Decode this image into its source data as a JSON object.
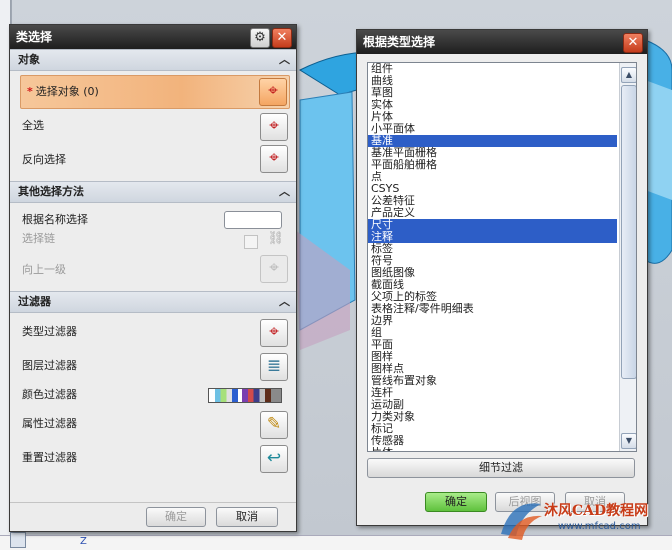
{
  "dialog_class_select": {
    "title": "类选择",
    "objects_section": {
      "title": "对象",
      "select_label": "选择对象 (0)",
      "select_all": "全选",
      "invert": "反向选择"
    },
    "other_methods_section": {
      "title": "其他选择方法",
      "by_name": "根据名称选择",
      "chain": "选择链",
      "up_level": "向上一级"
    },
    "filters_section": {
      "title": "过滤器",
      "type_filter": "类型过滤器",
      "layer_filter": "图层过滤器",
      "color_filter": "颜色过滤器",
      "attribute_filter": "属性过滤器",
      "reset_filter": "重置过滤器"
    },
    "ok": "确定",
    "cancel": "取消"
  },
  "dialog_by_type": {
    "title": "根据类型选择",
    "items": [
      {
        "label": "组件",
        "selected": false
      },
      {
        "label": "曲线",
        "selected": false
      },
      {
        "label": "草图",
        "selected": false
      },
      {
        "label": "实体",
        "selected": false
      },
      {
        "label": "片体",
        "selected": false
      },
      {
        "label": "小平面体",
        "selected": false
      },
      {
        "label": "基准",
        "selected": true
      },
      {
        "label": "基准平面栅格",
        "selected": false
      },
      {
        "label": "平面船舶栅格",
        "selected": false
      },
      {
        "label": "点",
        "selected": false
      },
      {
        "label": "CSYS",
        "selected": false
      },
      {
        "label": "公差特征",
        "selected": false
      },
      {
        "label": "产品定义",
        "selected": false
      },
      {
        "label": "尺寸",
        "selected": true
      },
      {
        "label": "注释",
        "selected": true
      },
      {
        "label": "标签",
        "selected": false
      },
      {
        "label": "符号",
        "selected": false
      },
      {
        "label": "图纸图像",
        "selected": false
      },
      {
        "label": "截面线",
        "selected": false
      },
      {
        "label": "父项上的标签",
        "selected": false
      },
      {
        "label": "表格注释/零件明细表",
        "selected": false
      },
      {
        "label": "边界",
        "selected": false
      },
      {
        "label": "组",
        "selected": false
      },
      {
        "label": "平面",
        "selected": false
      },
      {
        "label": "图样",
        "selected": false
      },
      {
        "label": "图样点",
        "selected": false
      },
      {
        "label": "管线布置对象",
        "selected": false
      },
      {
        "label": "连杆",
        "selected": false
      },
      {
        "label": "运动副",
        "selected": false
      },
      {
        "label": "力类对象",
        "selected": false
      },
      {
        "label": "标记",
        "selected": false
      },
      {
        "label": "传感器",
        "selected": false
      },
      {
        "label": "片体",
        "selected": false
      }
    ],
    "detail_filter": "细节过滤",
    "ok": "确定",
    "back": "后视图",
    "cancel": "取消"
  },
  "watermark": {
    "text": "沐风CAD教程网",
    "url": "www.mfcad.com"
  },
  "background": {
    "axis_label": "Z"
  },
  "colors": {
    "accent_orange": "#f2b37c",
    "selection_blue": "#2d5ec7",
    "ok_green": "#5fc13d",
    "close_red": "#c43c1c"
  }
}
